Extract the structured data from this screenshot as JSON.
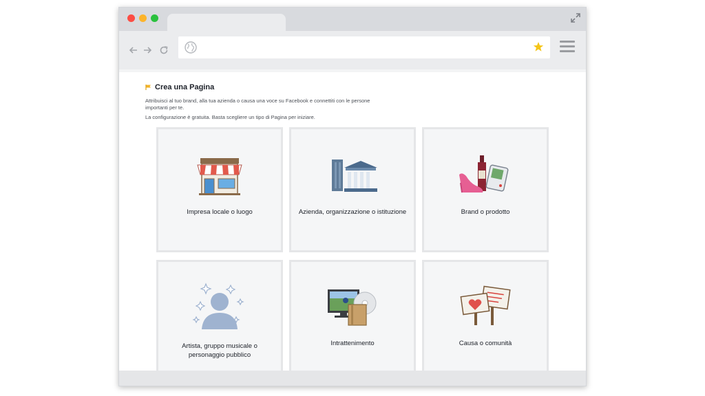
{
  "page": {
    "title": "Crea una Pagina",
    "description": "Attribuisci al tuo brand, alla tua azienda o causa una voce su Facebook e connettiti con le persone importanti per te.",
    "subdescription": "La configurazione è gratuita. Basta scegliere un tipo di Pagina per iniziare."
  },
  "browser": {
    "url": "",
    "icons": [
      "back-arrow-icon",
      "forward-arrow-icon",
      "reload-icon",
      "globe-icon",
      "bookmark-star-icon",
      "hamburger-menu-icon",
      "expand-icon"
    ],
    "colors": {
      "close": "#fc4d44",
      "minimize": "#fcb42a",
      "maximize": "#2ac13e",
      "star": "#f5c518"
    }
  },
  "categories": [
    {
      "label": "Impresa locale o luogo",
      "icon": "storefront-icon"
    },
    {
      "label": "Azienda, organizzazione o istituzione",
      "icon": "company-building-icon"
    },
    {
      "label": "Brand o prodotto",
      "icon": "brand-product-icon"
    },
    {
      "label": "Artista, gruppo musicale o personaggio pubblico",
      "icon": "public-figure-icon"
    },
    {
      "label": "Intrattenimento",
      "icon": "entertainment-icon"
    },
    {
      "label": "Causa o comunità",
      "icon": "cause-community-icon"
    }
  ]
}
